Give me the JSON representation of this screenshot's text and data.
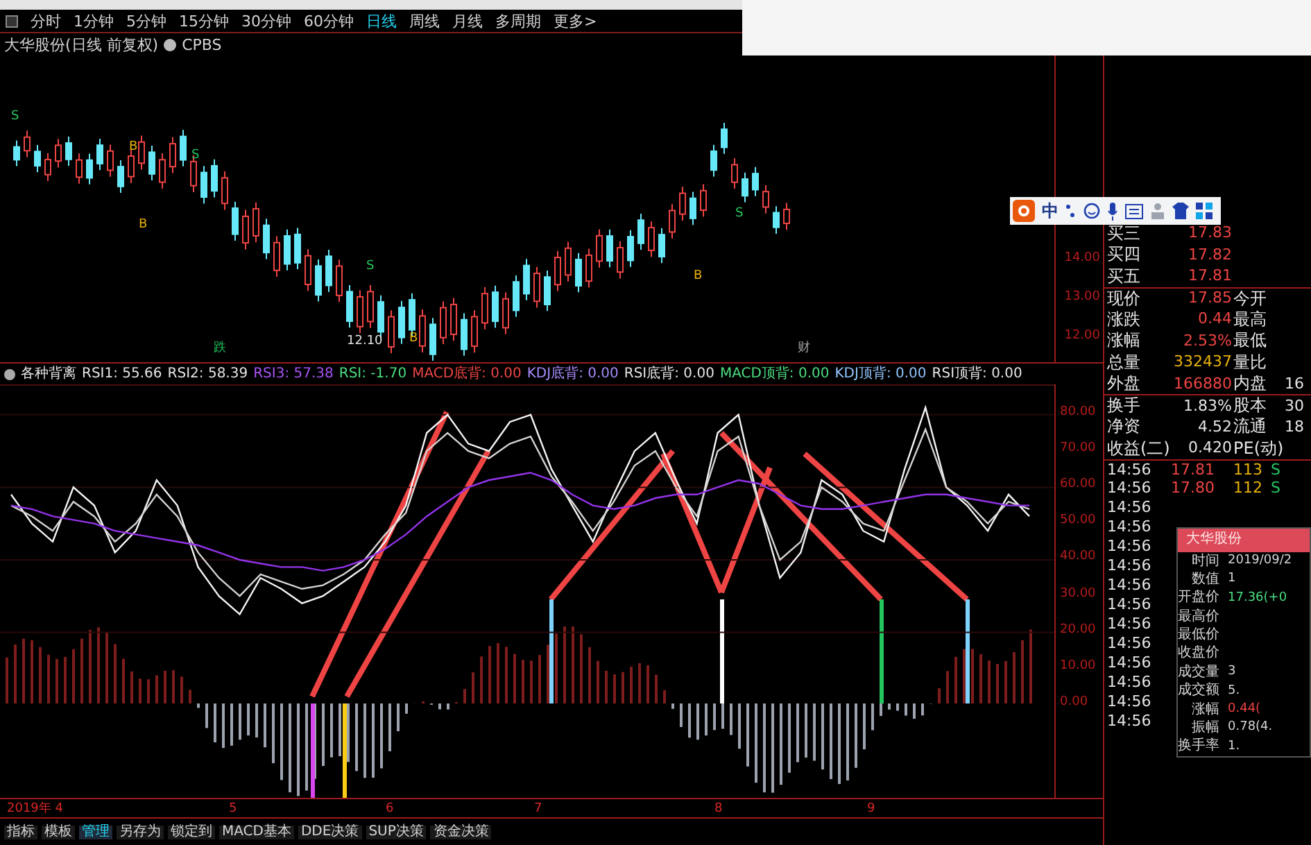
{
  "period_tabs": [
    {
      "label": "分时",
      "selected": false
    },
    {
      "label": "1分钟",
      "selected": false
    },
    {
      "label": "5分钟",
      "selected": false
    },
    {
      "label": "15分钟",
      "selected": false
    },
    {
      "label": "30分钟",
      "selected": false
    },
    {
      "label": "60分钟",
      "selected": false
    },
    {
      "label": "日线",
      "selected": true
    },
    {
      "label": "周线",
      "selected": false
    },
    {
      "label": "月线",
      "selected": false
    },
    {
      "label": "多周期",
      "selected": false
    },
    {
      "label": "更多>",
      "selected": false
    }
  ],
  "stock_title": {
    "name": "大华股份(日线 前复权)",
    "indicator": "CPBS"
  },
  "price_chart": {
    "ticks": [
      "14.00",
      "13.00",
      "12.00"
    ],
    "markers": [
      {
        "text": "S",
        "color": "#22c55e"
      },
      {
        "text": "B",
        "color": "#eab308"
      },
      {
        "text": "S",
        "color": "#22c55e"
      },
      {
        "text": "B",
        "color": "#eab308"
      },
      {
        "text": "S",
        "color": "#22c55e"
      },
      {
        "text": "B",
        "color": "#eab308"
      },
      {
        "text": "12.10",
        "color": "#e5e5e5"
      },
      {
        "text": "S",
        "color": "#22c55e"
      },
      {
        "text": "B",
        "color": "#eab308"
      },
      {
        "text": "跌",
        "color": "#22c55e"
      },
      {
        "text": "财",
        "color": "#a3a3a3"
      }
    ]
  },
  "indicator_header": {
    "title": "各种背离",
    "items": [
      {
        "text": "RSI1: 55.66",
        "color": "#e5e5e5"
      },
      {
        "text": "RSI2: 58.39",
        "color": "#e5e5e5"
      },
      {
        "text": "RSI3: 57.38",
        "color": "#a855f7"
      },
      {
        "text": "RSI: -1.70",
        "color": "#4ade80"
      },
      {
        "text": "MACD底背: 0.00",
        "color": "#ef4444"
      },
      {
        "text": "KDJ底背: 0.00",
        "color": "#a78bfa"
      },
      {
        "text": "RSI底背: 0.00",
        "color": "#e5e5e5"
      },
      {
        "text": "MACD顶背: 0.00",
        "color": "#4ade80"
      },
      {
        "text": "KDJ顶背: 0.00",
        "color": "#93c5fd"
      },
      {
        "text": "RSI顶背: 0.00",
        "color": "#e5e5e5"
      }
    ]
  },
  "indicator_chart": {
    "chart_data": {
      "type": "line",
      "grid": true,
      "ylim": [
        -26,
        88
      ],
      "yticks": [
        {
          "value": 80,
          "label": "80.00"
        },
        {
          "value": 70,
          "label": "70.00"
        },
        {
          "value": 60,
          "label": "60.00"
        },
        {
          "value": 50,
          "label": "50.00"
        },
        {
          "value": 40,
          "label": "40.00"
        },
        {
          "value": 30,
          "label": "30.00"
        },
        {
          "value": 20,
          "label": "20.00"
        },
        {
          "value": 10,
          "label": "10.00"
        },
        {
          "value": 0,
          "label": "0.00"
        }
      ],
      "series": [
        {
          "color": "#f5f5f5",
          "values": [
            58,
            50,
            45,
            60,
            55,
            42,
            48,
            62,
            55,
            38,
            30,
            25,
            35,
            32,
            28,
            30,
            34,
            38,
            45,
            55,
            75,
            80,
            72,
            70,
            78,
            80,
            65,
            55,
            45,
            58,
            70,
            75,
            62,
            50,
            75,
            80,
            55,
            35,
            42,
            62,
            58,
            48,
            45,
            65,
            82,
            60,
            55,
            48,
            58,
            52
          ]
        },
        {
          "color": "#d6d3d1",
          "values": [
            55,
            52,
            48,
            56,
            52,
            45,
            50,
            58,
            52,
            42,
            35,
            30,
            36,
            34,
            32,
            33,
            36,
            40,
            47,
            53,
            70,
            75,
            70,
            68,
            72,
            74,
            63,
            56,
            48,
            56,
            66,
            70,
            60,
            52,
            70,
            74,
            55,
            40,
            45,
            60,
            56,
            50,
            48,
            62,
            76,
            60,
            56,
            50,
            56,
            54
          ]
        },
        {
          "color": "#9333ea",
          "values": [
            55,
            54,
            52,
            51,
            50,
            48,
            47,
            46,
            45,
            44,
            42,
            40,
            39,
            38,
            38,
            37,
            38,
            40,
            43,
            47,
            52,
            56,
            60,
            62,
            63,
            64,
            62,
            58,
            55,
            54,
            55,
            57,
            58,
            58,
            60,
            62,
            61,
            58,
            55,
            54,
            54,
            55,
            56,
            57,
            58,
            58,
            57,
            56,
            55,
            55
          ]
        }
      ]
    }
  },
  "date_axis": [
    "2019年 4",
    "5",
    "6",
    "7",
    "8",
    "9"
  ],
  "bottom_tabs": [
    {
      "label": "指标",
      "selected": false
    },
    {
      "label": "模板",
      "selected": false
    },
    {
      "label": "管理",
      "selected": true
    },
    {
      "label": "另存为",
      "selected": false
    },
    {
      "label": "锁定到",
      "selected": false
    },
    {
      "label": "MACD基本",
      "selected": false
    },
    {
      "label": "DDE决策",
      "selected": false
    },
    {
      "label": "SUP决策",
      "selected": false
    },
    {
      "label": "资金决策",
      "selected": false
    }
  ],
  "ime_toolbar": {
    "mode": "中"
  },
  "quote_rows": [
    {
      "label": "买三",
      "value": "17.83",
      "color": "#ef4444"
    },
    {
      "label": "买四",
      "value": "17.82",
      "color": "#ef4444"
    },
    {
      "label": "买五",
      "value": "17.81",
      "color": "#ef4444"
    },
    {
      "label": "现价",
      "value": "17.85",
      "color": "#ef4444",
      "label2": "今开"
    },
    {
      "label": "涨跌",
      "value": "0.44",
      "color": "#ef4444",
      "label2": "最高"
    },
    {
      "label": "涨幅",
      "value": "2.53%",
      "color": "#ef4444",
      "label2": "最低"
    },
    {
      "label": "总量",
      "value": "332437",
      "color": "#eab308",
      "label2": "量比"
    },
    {
      "label": "外盘",
      "value": "166880",
      "color": "#ef4444",
      "label2": "内盘",
      "value2": "16"
    },
    {
      "label": "换手",
      "value": "1.83%",
      "color": "#e5e5e5",
      "label2": "股本",
      "value2": "30"
    },
    {
      "label": "净资",
      "value": "4.52",
      "color": "#e5e5e5",
      "label2": "流通",
      "value2": "18"
    },
    {
      "label": "收益(二)",
      "value": "0.420",
      "color": "#e5e5e5",
      "label2": "PE(动)"
    }
  ],
  "ticks": [
    {
      "time": "14:56",
      "price": "17.81",
      "volume": "113",
      "flag": "S"
    },
    {
      "time": "14:56",
      "price": "17.80",
      "volume": "112",
      "flag": "S"
    },
    {
      "time": "14:56"
    },
    {
      "time": "14:56"
    },
    {
      "time": "14:56"
    },
    {
      "time": "14:56"
    },
    {
      "time": "14:56"
    },
    {
      "time": "14:56"
    },
    {
      "time": "14:56"
    },
    {
      "time": "14:56"
    },
    {
      "time": "14:56"
    },
    {
      "time": "14:56"
    },
    {
      "time": "14:56"
    },
    {
      "time": "14:56"
    }
  ],
  "popup": {
    "title": "大华股份",
    "rows": [
      {
        "label": "时间",
        "value": "2019/09/2"
      },
      {
        "label": "数值",
        "value": "1"
      },
      {
        "label": "开盘价",
        "value": "17.36(+0",
        "color": "#4ade80"
      },
      {
        "label": "最高价"
      },
      {
        "label": "最低价"
      },
      {
        "label": "收盘价"
      },
      {
        "label": "成交量",
        "value": "3"
      },
      {
        "label": "成交额",
        "value": "5."
      },
      {
        "label": "涨幅",
        "value": "0.44(",
        "color": "#ef4444"
      },
      {
        "label": "振幅",
        "value": "0.78(4."
      },
      {
        "label": "换手率",
        "value": "1."
      }
    ]
  }
}
